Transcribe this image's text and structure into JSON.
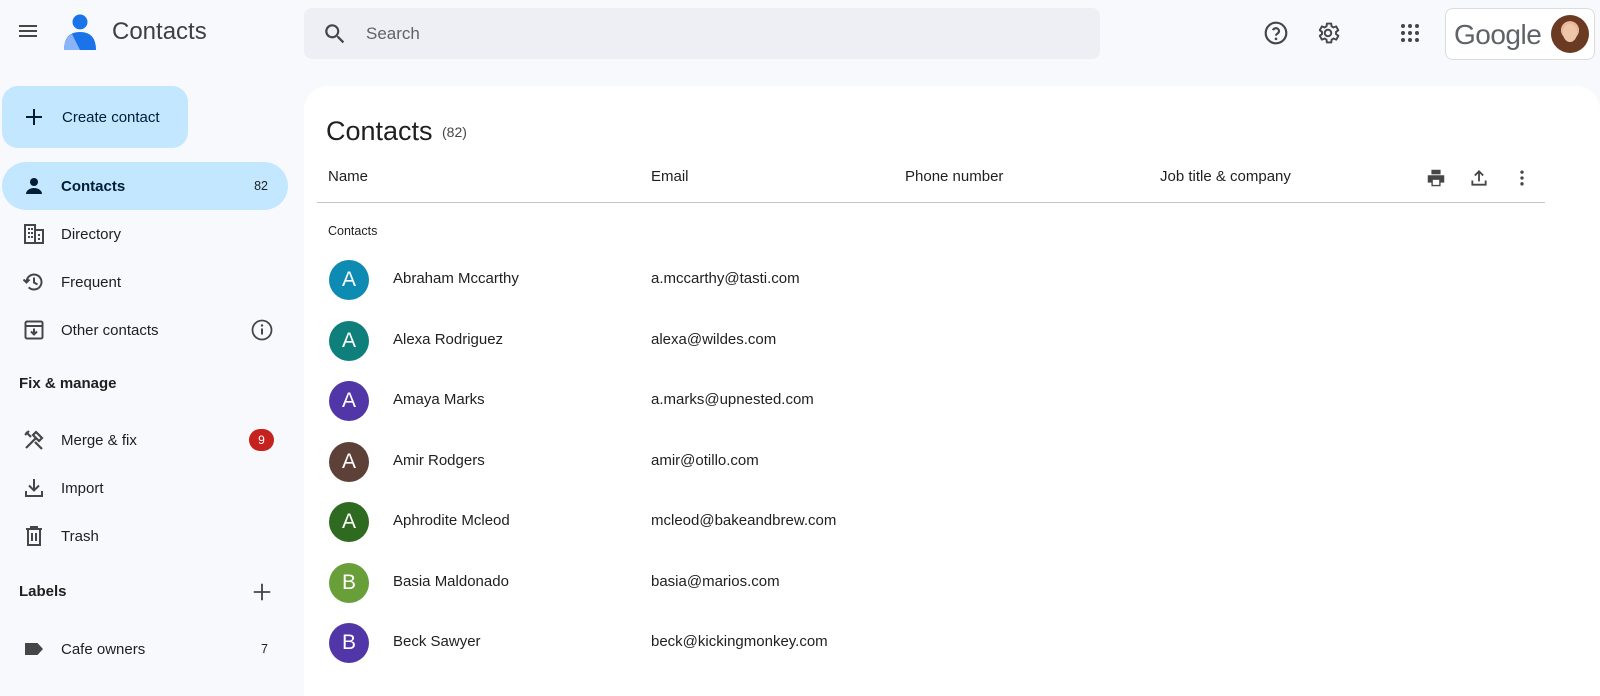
{
  "header": {
    "app_title": "Contacts",
    "search_placeholder": "Search",
    "account_brand": "Google"
  },
  "sidebar": {
    "create_label": "Create contact",
    "nav": [
      {
        "label": "Contacts",
        "count": "82",
        "icon": "person-icon"
      },
      {
        "label": "Directory",
        "icon": "building-icon"
      },
      {
        "label": "Frequent",
        "icon": "history-icon"
      },
      {
        "label": "Other contacts",
        "icon": "archive-icon"
      }
    ],
    "fix_manage_header": "Fix & manage",
    "fix": [
      {
        "label": "Merge & fix",
        "badge": "9",
        "icon": "merge-fix-icon"
      },
      {
        "label": "Import",
        "icon": "download-icon"
      },
      {
        "label": "Trash",
        "icon": "trash-icon"
      }
    ],
    "labels_header": "Labels",
    "labels": [
      {
        "label": "Cafe owners",
        "count": "7",
        "icon": "label-icon"
      }
    ]
  },
  "main": {
    "title": "Contacts",
    "count": "(82)",
    "columns": [
      "Name",
      "Email",
      "Phone number",
      "Job title & company"
    ],
    "group_label": "Contacts",
    "rows": [
      {
        "initial": "A",
        "name": "Abraham Mccarthy",
        "email": "a.mccarthy@tasti.com",
        "color": "#0e8bb2"
      },
      {
        "initial": "A",
        "name": "Alexa Rodriguez",
        "email": "alexa@wildes.com",
        "color": "#0f7f7c"
      },
      {
        "initial": "A",
        "name": "Amaya Marks",
        "email": "a.marks@upnested.com",
        "color": "#5136a8"
      },
      {
        "initial": "A",
        "name": "Amir Rodgers",
        "email": "amir@otillo.com",
        "color": "#5d4037"
      },
      {
        "initial": "A",
        "name": "Aphrodite Mcleod",
        "email": "mcleod@bakeandbrew.com",
        "color": "#2e6a1f"
      },
      {
        "initial": "B",
        "name": "Basia Maldonado",
        "email": "basia@marios.com",
        "color": "#689f38"
      },
      {
        "initial": "B",
        "name": "Beck Sawyer",
        "email": "beck@kickingmonkey.com",
        "color": "#5136a8"
      }
    ]
  },
  "colors": {
    "accent": "#c2e7ff",
    "badge": "#c5221f",
    "background": "#f8f9fd"
  }
}
